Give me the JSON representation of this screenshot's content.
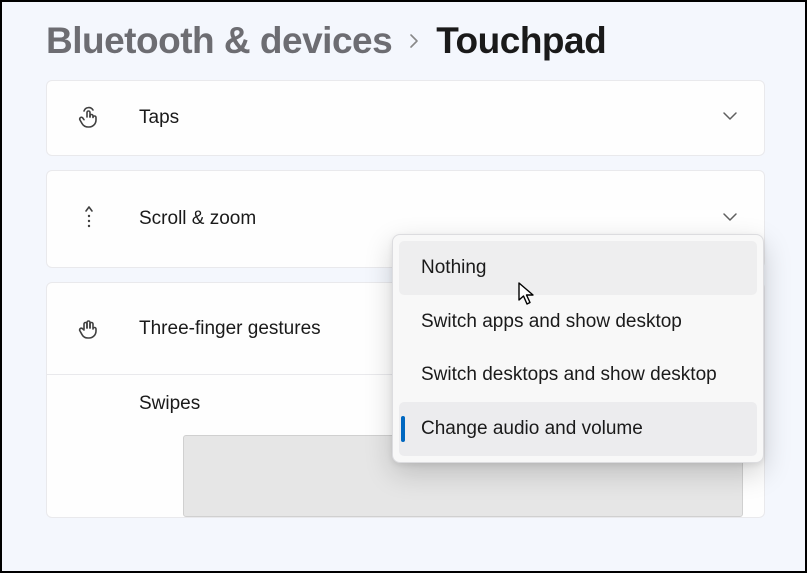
{
  "breadcrumb": {
    "parent": "Bluetooth & devices",
    "current": "Touchpad"
  },
  "panels": {
    "taps": {
      "title": "Taps"
    },
    "scroll_zoom": {
      "title": "Scroll & zoom"
    },
    "three_finger": {
      "title": "Three-finger gestures"
    }
  },
  "three_finger_sub": {
    "swipes_label": "Swipes"
  },
  "dropdown": {
    "items": [
      {
        "label": "Nothing"
      },
      {
        "label": "Switch apps and show desktop"
      },
      {
        "label": "Switch desktops and show desktop"
      },
      {
        "label": "Change audio and volume"
      }
    ],
    "hovered_index": 0,
    "selected_index": 3
  }
}
